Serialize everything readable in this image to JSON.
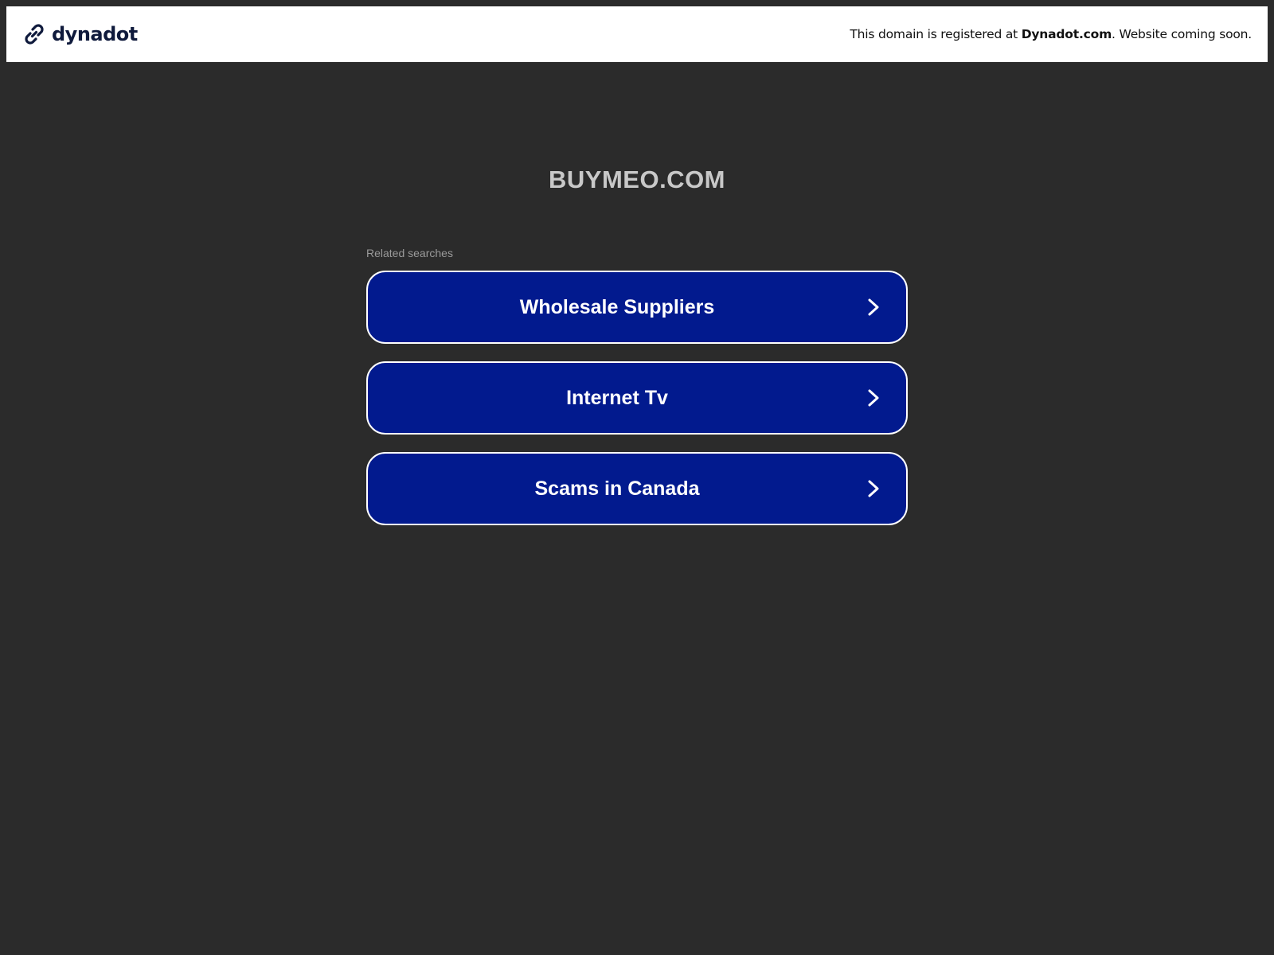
{
  "header": {
    "brand_name": "dynadot",
    "notice_prefix": "This domain is registered at ",
    "notice_link": "Dynadot.com",
    "notice_suffix": ". Website coming soon."
  },
  "main": {
    "domain": "BUYMEO.COM",
    "related_label": "Related searches",
    "searches": [
      {
        "label": "Wholesale Suppliers"
      },
      {
        "label": "Internet Tv"
      },
      {
        "label": "Scams in Canada"
      }
    ]
  },
  "colors": {
    "page_background": "#2b2b2b",
    "topbar_background": "#ffffff",
    "button_background": "#021a8e",
    "button_border": "#ffffff",
    "brand_text": "#0f1a3c"
  },
  "icons": {
    "brand": "link-chain-icon",
    "row_arrow": "chevron-right-icon"
  }
}
